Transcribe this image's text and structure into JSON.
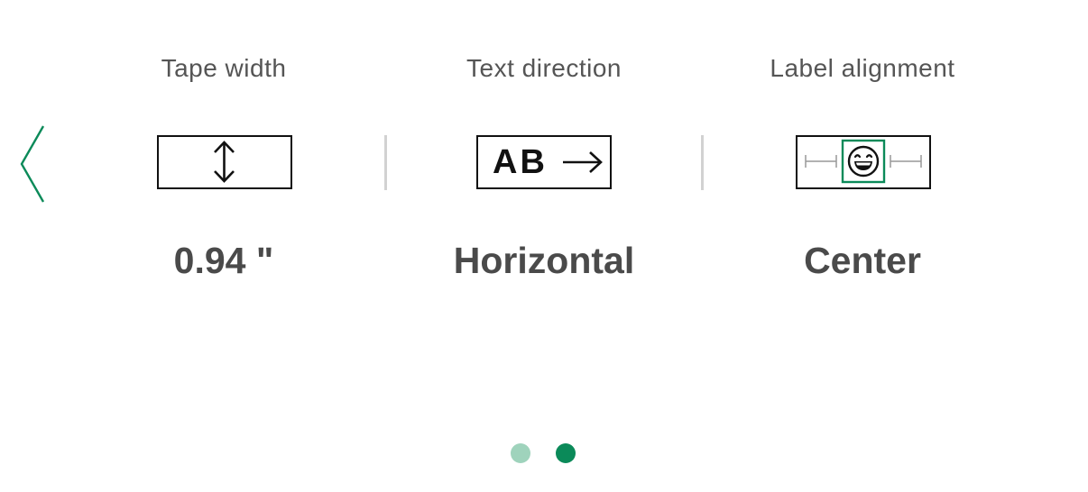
{
  "colors": {
    "accent": "#0b8a59",
    "dot_inactive": "#9fd3bc",
    "dot_active": "#0b8a59",
    "divider": "#d2d2d2",
    "title_text": "#555555",
    "value_text": "#4a4a4a"
  },
  "navigation": {
    "back_icon": "chevron-left-icon"
  },
  "settings": [
    {
      "title": "Tape width",
      "icon": "vertical-double-arrow-icon",
      "value": "0.94 \""
    },
    {
      "title": "Text direction",
      "icon": "text-horizontal-icon",
      "icon_text": "AB",
      "value": "Horizontal"
    },
    {
      "title": "Label alignment",
      "icon": "align-center-smiley-icon",
      "value": "Center"
    }
  ],
  "pagination": {
    "total": 2,
    "current": 2
  }
}
